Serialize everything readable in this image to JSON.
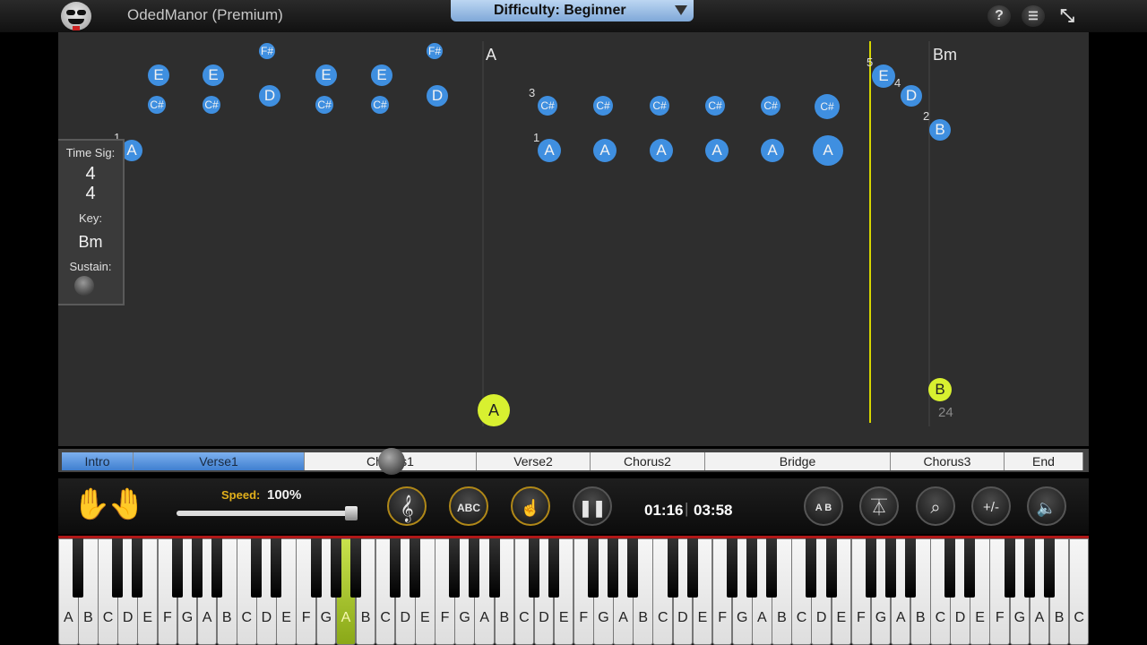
{
  "app": {
    "title": "OdedManor (Premium)"
  },
  "difficulty": {
    "label": "Difficulty: Beginner"
  },
  "top_icons": [
    "help-icon",
    "menu-icon",
    "fullscreen-icon"
  ],
  "score": {
    "chords": [
      "A",
      "Bm"
    ],
    "measure_number": "24",
    "fingerings": [
      "1",
      "3",
      "1",
      "5",
      "4",
      "2"
    ],
    "notes": {
      "n1": "E",
      "n2": "E",
      "n3": "E",
      "n4": "E",
      "n5": "C#",
      "n6": "C#",
      "n7": "C#",
      "n8": "C#",
      "n9": "D",
      "n10": "D",
      "n11": "F#",
      "n12": "F#",
      "n13": "A",
      "n14": "C#",
      "n15": "C#",
      "n16": "C#",
      "n17": "C#",
      "n18": "C#",
      "n19": "C#",
      "n20": "A",
      "n21": "A",
      "n22": "A",
      "n23": "A",
      "n24": "A",
      "n25": "A",
      "n26": "E",
      "n27": "D",
      "n28": "B",
      "n29": "A",
      "n30": "B"
    }
  },
  "info_panel": {
    "time_sig_label": "Time Sig:",
    "time_sig_top": "4",
    "time_sig_bottom": "4",
    "key_label": "Key:",
    "key_value": "Bm",
    "sustain_label": "Sustain:"
  },
  "sections": [
    "Intro",
    "Verse1",
    "Chorus1",
    "Verse2",
    "Chorus2",
    "Bridge",
    "Chorus3",
    "End"
  ],
  "sections_completed": 2,
  "controls": {
    "speed_label": "Speed:",
    "speed_value": "100%",
    "speed_fraction": 1.0,
    "time_current": "01:16",
    "time_total": "03:58",
    "buttons": {
      "abc": "ABC",
      "loop": "A B",
      "plus_minus": "+/-"
    }
  },
  "keyboard": {
    "white_keys": [
      "A",
      "B",
      "C",
      "D",
      "E",
      "F",
      "G",
      "A",
      "B",
      "C",
      "D",
      "E",
      "F",
      "G",
      "A",
      "B",
      "C",
      "D",
      "E",
      "F",
      "G",
      "A",
      "B",
      "C",
      "D",
      "E",
      "F",
      "G",
      "A",
      "B",
      "C",
      "D",
      "E",
      "F",
      "G",
      "A",
      "B",
      "C",
      "D",
      "E",
      "F",
      "G",
      "A",
      "B",
      "C",
      "D",
      "E",
      "F",
      "G",
      "A",
      "B",
      "C"
    ],
    "active_key_index": 14
  },
  "colors": {
    "note": "#3f8fe0",
    "accent": "#d8f030",
    "playhead": "#d6d600",
    "gold": "#e2b01b"
  }
}
